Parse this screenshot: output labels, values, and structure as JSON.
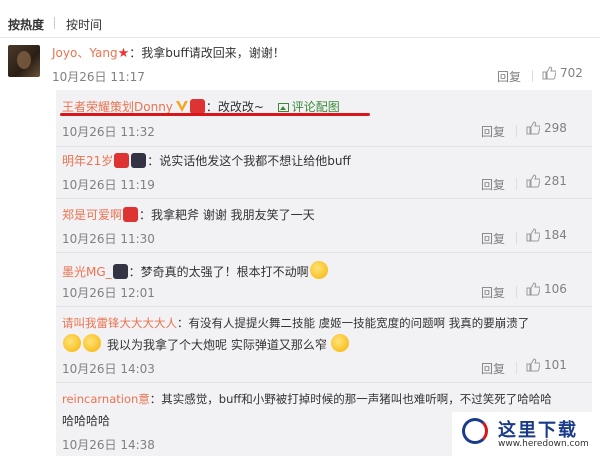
{
  "tabs": {
    "hot": "按热度",
    "time": "按时间"
  },
  "main_comment": {
    "user": "Joyo、Yang",
    "text": "：我拿buff请改回来，谢谢！",
    "time": "10月26日 11:17",
    "reply_label": "回复",
    "likes": "702"
  },
  "replies": [
    {
      "user": "王者荣耀策划Donny",
      "text": "：改改改~",
      "pic_link": "评论配图",
      "time": "10月26日 11:32",
      "reply_label": "回复",
      "likes": "298"
    },
    {
      "user": "明年21岁",
      "text": "：说实话他发这个我都不想让给他buff",
      "time": "10月26日 11:19",
      "reply_label": "回复",
      "likes": "281"
    },
    {
      "user": "郑是可爱啊",
      "text": "：我拿耙斧 谢谢 我朋友笑了一天",
      "time": "10月26日 11:30",
      "reply_label": "回复",
      "likes": "184"
    },
    {
      "user": "墨光MG_",
      "text": "：梦奇真的太强了！根本打不动啊",
      "time": "10月26日 12:01",
      "reply_label": "回复",
      "likes": "106"
    },
    {
      "user": "请叫我雷锋大大大大人",
      "text": "：有没有人提提火舞二技能 虞姬一技能宽度的问题啊 我真的要崩溃了",
      "text2": "我以为我拿了个大炮呢 实际弹道又那么窄",
      "time": "10月26日 14:03",
      "reply_label": "回复",
      "likes": "101"
    },
    {
      "user": "reincarnation意",
      "text": "：其实感觉，buff和小野被打掉时候的那一声猪叫也难听啊，不过笑死了哈哈哈",
      "text2": "哈哈哈哈",
      "time": "10月26日 14:38"
    }
  ],
  "watermark": {
    "name": "这里下载",
    "url": "www.heredown.com"
  },
  "colors": {
    "username": "#eb7350",
    "link": "#3a8a3a",
    "highlight": "#d9161a"
  }
}
